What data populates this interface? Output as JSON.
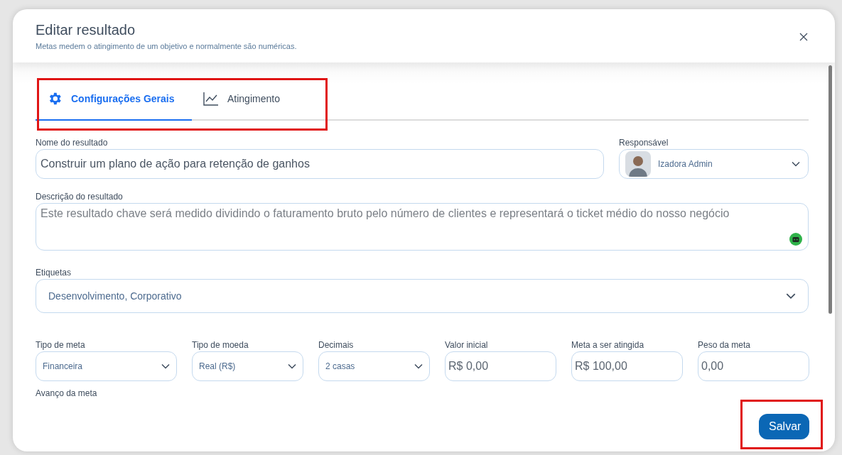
{
  "dialog": {
    "title": "Editar resultado",
    "subtitle": "Metas medem o atingimento de um objetivo e normalmente são numéricas."
  },
  "tabs": {
    "highlighted": true,
    "items": [
      {
        "label": "Configurações Gerais",
        "kind": "gear",
        "selected": true
      },
      {
        "label": "Atingimento",
        "kind": "chart",
        "selected": false
      }
    ]
  },
  "name_field": {
    "label": "Nome do resultado",
    "value": "Construir um plano de ação para retenção de ganhos"
  },
  "owner_field": {
    "label": "Responsável",
    "value": "Izadora Admin"
  },
  "description_field": {
    "label": "Descrição do resultado",
    "value": "Este resultado chave será medido dividindo o faturamento bruto pelo número de clientes e representará o ticket médio do nosso negócio"
  },
  "tags_field": {
    "label": "Etiquetas",
    "value": "Desenvolvimento, Corporativo"
  },
  "metric_fields": [
    {
      "label": "Tipo de meta",
      "value": "Financeira",
      "kind": "select"
    },
    {
      "label": "Tipo de moeda",
      "value": "Real (R$)",
      "kind": "select"
    },
    {
      "label": "Decimais",
      "value": "2 casas",
      "kind": "select"
    },
    {
      "label": "Valor inicial",
      "value": "R$ 0,00",
      "kind": "input"
    },
    {
      "label": "Meta a ser atingida",
      "value": "R$ 100,00",
      "kind": "input"
    },
    {
      "label": "Peso da meta",
      "value": "0,00",
      "kind": "input"
    }
  ],
  "progress_label": "Avanço da meta",
  "footer": {
    "save_button": {
      "label": "Salvar",
      "highlighted": true
    }
  }
}
